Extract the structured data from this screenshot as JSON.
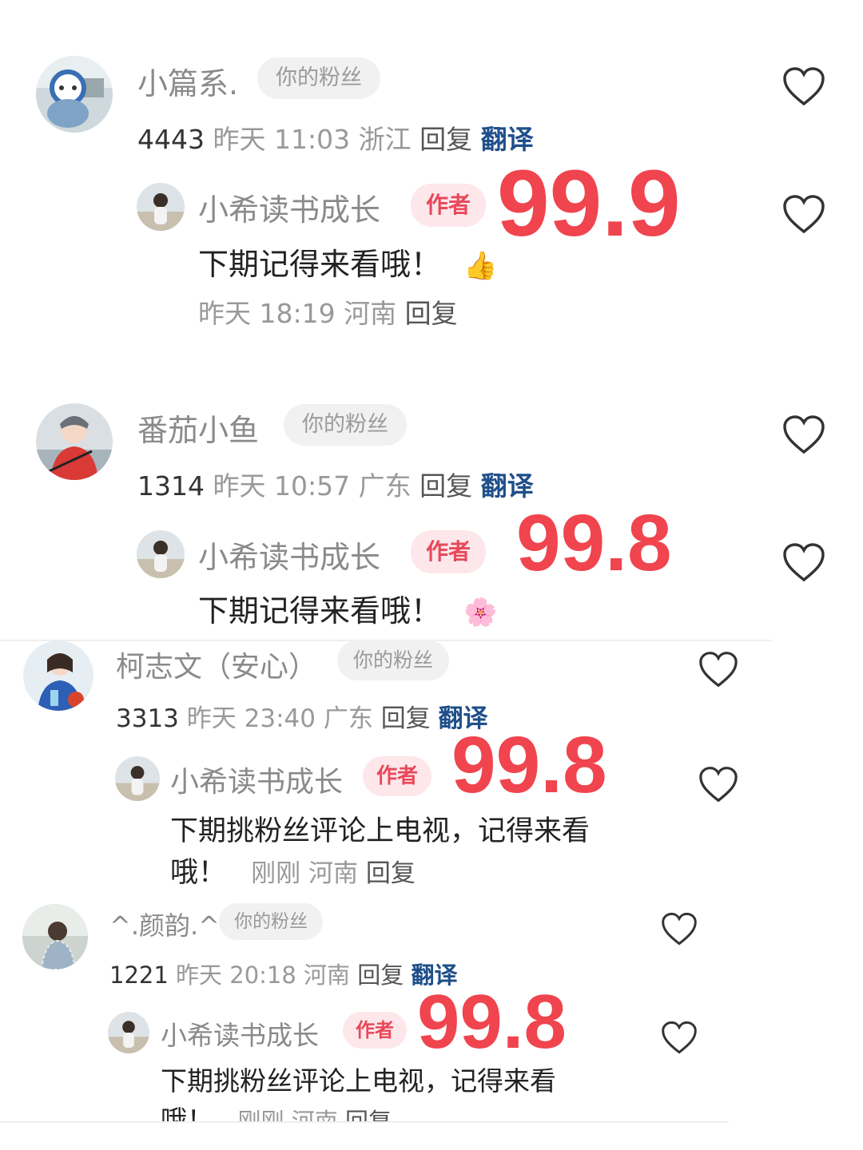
{
  "comments": [
    {
      "user": {
        "name": "小篇系.",
        "badge": "你的粉丝",
        "count": "4443",
        "time": "昨天 11:03",
        "location": "浙江",
        "reply": "回复",
        "translate": "翻译"
      },
      "author": {
        "name": "小希读书成长",
        "badge": "作者",
        "text": "下期记得来看哦！",
        "emoji": "👍",
        "time": "昨天 18:19",
        "location": "河南",
        "reply": "回复"
      },
      "score": "99.9"
    },
    {
      "user": {
        "name": "番茄小鱼",
        "badge": "你的粉丝",
        "count": "1314",
        "time": "昨天 10:57",
        "location": "广东",
        "reply": "回复",
        "translate": "翻译"
      },
      "author": {
        "name": "小希读书成长",
        "badge": "作者",
        "text": "下期记得来看哦！",
        "emoji": "🌸"
      },
      "score": "99.8"
    },
    {
      "user": {
        "name": "柯志文（安心）",
        "badge": "你的粉丝",
        "count": "3313",
        "time": "昨天 23:40",
        "location": "广东",
        "reply": "回复",
        "translate": "翻译"
      },
      "author": {
        "name": "小希读书成长",
        "badge": "作者",
        "text_line1": "下期挑粉丝评论上电视，记得来看",
        "text_line2": "哦！",
        "time": "刚刚",
        "location": "河南",
        "reply": "回复"
      },
      "score": "99.8"
    },
    {
      "user": {
        "name": "^.颜韵.^",
        "badge": "你的粉丝",
        "count": "1221",
        "time": "昨天 20:18",
        "location": "河南",
        "reply": "回复",
        "translate": "翻译"
      },
      "author": {
        "name": "小希读书成长",
        "badge": "作者",
        "text_line1": "下期挑粉丝评论上电视，记得来看",
        "text_line2": "哦！",
        "time": "刚刚",
        "location": "河南",
        "reply": "回复"
      },
      "score": "99.8"
    }
  ],
  "colors": {
    "accent": "#f0444e",
    "translate": "#1f4f8a",
    "author_badge_bg": "#fde7ea",
    "author_badge_text": "#e8485a"
  },
  "icons": {
    "like": "heart-outline-icon"
  }
}
